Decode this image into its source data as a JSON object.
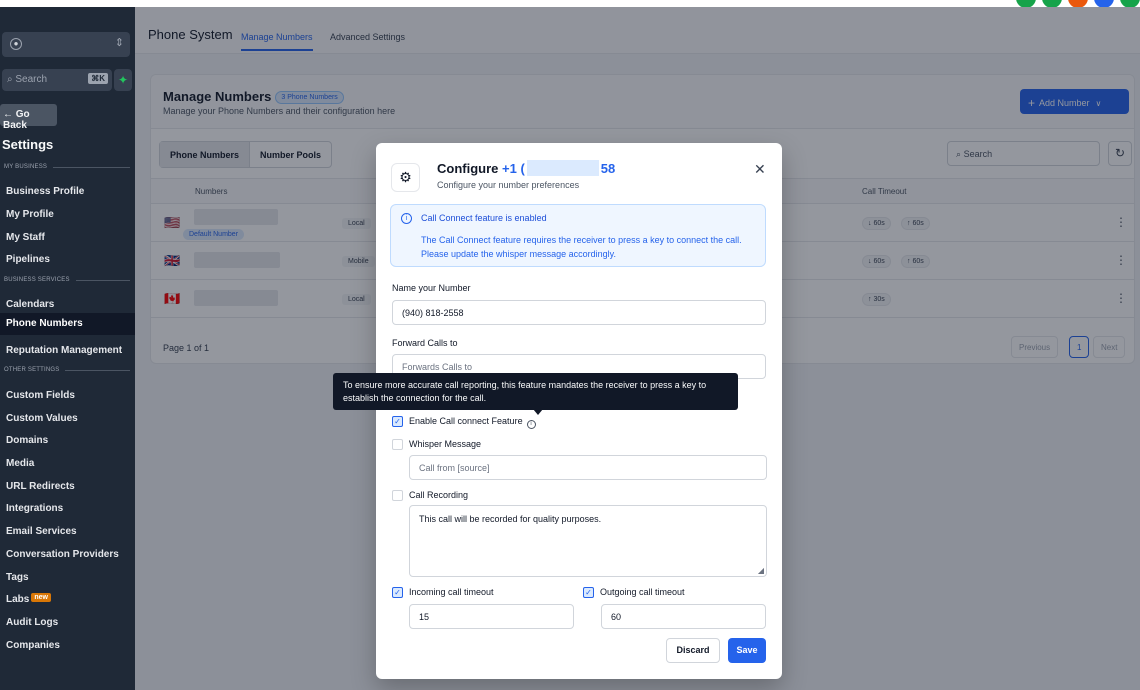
{
  "colors": {
    "accent": "#2563eb",
    "sidebar": "#1f2937",
    "tooltip": "#111827"
  },
  "sidebar": {
    "search_placeholder": "Search",
    "search_shortcut": "⌘K",
    "go_back": "Go Back",
    "title": "Settings",
    "sections": {
      "my_business": "MY BUSINESS",
      "business_services": "BUSINESS SERVICES",
      "other_settings": "OTHER SETTINGS"
    },
    "items": {
      "business_profile": "Business Profile",
      "my_profile": "My Profile",
      "my_staff": "My Staff",
      "pipelines": "Pipelines",
      "calendars": "Calendars",
      "phone_numbers": "Phone Numbers",
      "reputation_management": "Reputation Management",
      "custom_fields": "Custom Fields",
      "custom_values": "Custom Values",
      "domains": "Domains",
      "media": "Media",
      "url_redirects": "URL Redirects",
      "integrations": "Integrations",
      "email_services": "Email Services",
      "conversation_providers": "Conversation Providers",
      "tags": "Tags",
      "labs": "Labs",
      "labs_badge": "new",
      "audit_logs": "Audit Logs",
      "companies": "Companies"
    }
  },
  "header": {
    "app_title": "Phone System",
    "tabs": {
      "manage_numbers": "Manage Numbers",
      "advanced_settings": "Advanced Settings"
    }
  },
  "card": {
    "title": "Manage Numbers",
    "count_badge": "3 Phone Numbers",
    "subtitle": "Manage your Phone Numbers and their configuration here",
    "add_button": "Add Number",
    "segments": {
      "phone_numbers": "Phone Numbers",
      "number_pools": "Number Pools"
    },
    "search_placeholder": "Search",
    "columns": {
      "numbers": "Numbers",
      "call_timeout": "Call Timeout"
    },
    "rows": [
      {
        "flag": "🇺🇸",
        "badge": "Default Number",
        "type": "Local",
        "timeouts": [
          "↓ 60s",
          "↑ 60s"
        ]
      },
      {
        "flag": "🇬🇧",
        "badge": "",
        "type": "Mobile",
        "timeouts": [
          "↓ 60s",
          "↑ 60s"
        ]
      },
      {
        "flag": "🇨🇦",
        "badge": "",
        "type": "Local",
        "timeouts": [
          "↑ 30s"
        ]
      }
    ],
    "pager": {
      "text": "Page 1 of 1",
      "previous": "Previous",
      "current": "1",
      "next": "Next"
    }
  },
  "modal": {
    "title_prefix": "Configure",
    "number_start": "+1 (",
    "number_end": "58",
    "subtitle": "Configure your number preferences",
    "alert_title": "Call Connect feature is enabled",
    "alert_body": "The Call Connect feature requires the receiver to press a key to connect the call. Please update the whisper message accordingly.",
    "name_label": "Name your Number",
    "name_value": "(940) 818-2558",
    "forward_label": "Forward Calls to",
    "forward_placeholder": "Forwards Calls to",
    "call_connect_label": "Enable Call connect Feature",
    "whisper_label": "Whisper Message",
    "whisper_placeholder": "Call from [source]",
    "recording_label": "Call Recording",
    "recording_value": "This call will be recorded for quality purposes.",
    "incoming_label": "Incoming call timeout",
    "incoming_value": "15",
    "outgoing_label": "Outgoing call timeout",
    "outgoing_value": "60",
    "discard": "Discard",
    "save": "Save",
    "checks": {
      "call_connect": true,
      "whisper": false,
      "recording": false,
      "incoming": true,
      "outgoing": true
    }
  },
  "tooltip": {
    "text": "To ensure more accurate call reporting, this feature mandates the receiver to press a key to establish the connection for the call."
  }
}
